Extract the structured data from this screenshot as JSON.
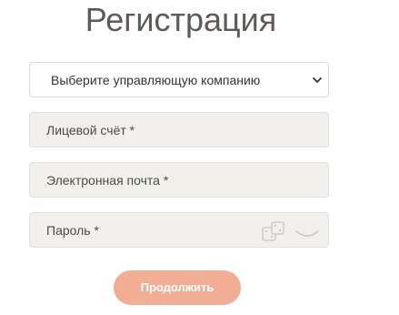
{
  "page": {
    "title": "Регистрация"
  },
  "form": {
    "company_select": {
      "selected": "Выберите управляющую компанию"
    },
    "account_field": {
      "placeholder": "Лицевой счёт *"
    },
    "email_field": {
      "placeholder": "Электронная почта *"
    },
    "password_field": {
      "placeholder": "Пароль *",
      "icons": [
        "dice-icon",
        "eye-closed-icon"
      ]
    },
    "submit_label": "Продолжить"
  },
  "colors": {
    "accent_button": "#f2ae95",
    "field_background": "#f2f0ec",
    "title_text": "#5e5a57"
  }
}
